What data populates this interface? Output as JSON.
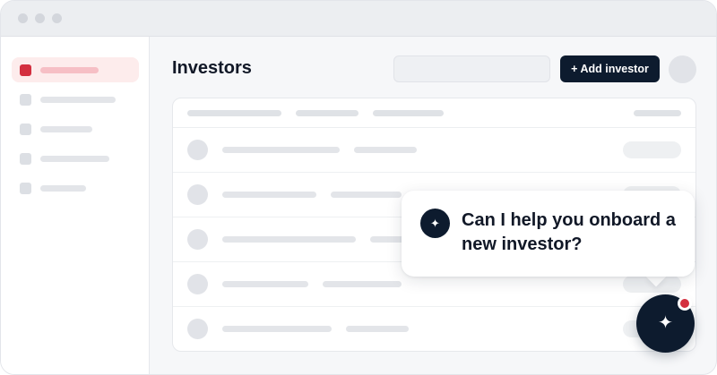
{
  "window": {
    "title_dots": [
      "close",
      "minimize",
      "maximize"
    ]
  },
  "sidebar": {
    "items": [
      {
        "name": "nav-item-1",
        "active": true
      },
      {
        "name": "nav-item-2",
        "active": false
      },
      {
        "name": "nav-item-3",
        "active": false
      },
      {
        "name": "nav-item-4",
        "active": false
      },
      {
        "name": "nav-item-5",
        "active": false
      }
    ]
  },
  "header": {
    "title": "Investors",
    "add_button_label": "+ Add investor"
  },
  "assistant": {
    "message": "Can I help you onboard a new investor?",
    "icon": "sparkle-icon",
    "notification": true
  },
  "colors": {
    "brand_dark": "#0d1b2e",
    "accent_red": "#d32f3f"
  }
}
